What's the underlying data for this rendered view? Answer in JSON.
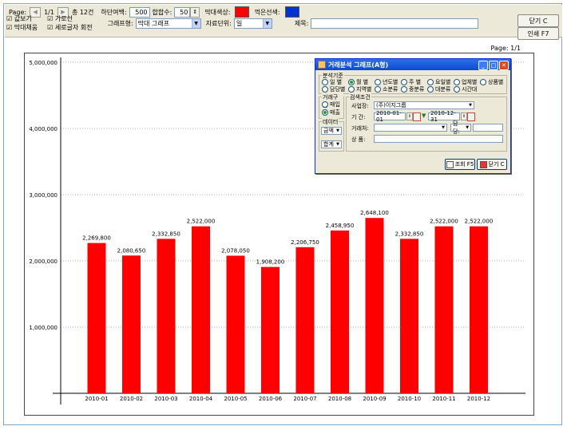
{
  "toolbar": {
    "page_label": "Page:",
    "page_value": "1/1",
    "total_label": "총 12건",
    "bottom_margin_label": "하단여백:",
    "bottom_margin_value": "500",
    "total_count_label": "합합수:",
    "total_count_value": "50",
    "bar_color_label": "막대색상:",
    "bar_color": "#ff0000",
    "line_color_label": "꺽은선색:",
    "line_color": "#0033cc",
    "checkbox_values": "☑ 값보기",
    "checkbox_bar_count": "☑ 막대채움",
    "checkbox_gridline": "☑ 가로선",
    "checkbox_rotate": "☑ 세로글자 회전",
    "graph_type_label": "그래프형:",
    "graph_type_value": "막대 그래프",
    "unit_label": "자료단위:",
    "unit_value": "일",
    "title_label": "제목:",
    "close_button": "닫기 C",
    "print_button": "인쇄 F7"
  },
  "page_indicator": "Page: 1/1",
  "dialog": {
    "title": "거래분석 그래프(A형)",
    "analysis_group_label": "분석기준",
    "analysis_options": [
      "일 별",
      "월 별",
      "년도별",
      "주 별",
      "요일별",
      "업체별",
      "상품별",
      "담당별",
      "지역별",
      "소분류",
      "중분류",
      "대분류",
      "시간대"
    ],
    "analysis_selected": "월 별",
    "trade_group_label": "거래구분",
    "trade_options": [
      "매입",
      "매출"
    ],
    "trade_selected": "매출",
    "search_group_label": "검색조건",
    "office_label": "사업장:",
    "office_value": "(주)이지그룹",
    "period_label": "기  간:",
    "period_from": "2010-01-01",
    "period_to": "2010-12-31",
    "partner_label": "거래처:",
    "staff_label": "담당:",
    "product_label": "상  품:",
    "data_group_label": "데이터",
    "data_value": "금액",
    "sum_value": "합계",
    "search_button": "조회 F5",
    "close_button": "닫기 C"
  },
  "chart_data": {
    "type": "bar",
    "categories": [
      "2010-01",
      "2010-02",
      "2010-03",
      "2010-04",
      "2010-05",
      "2010-06",
      "2010-07",
      "2010-08",
      "2010-09",
      "2010-10",
      "2010-11",
      "2010-12"
    ],
    "values": [
      2269800,
      2080650,
      2332850,
      2522000,
      2078050,
      1908200,
      2206750,
      2458950,
      2648100,
      2332850,
      2522000,
      2522000
    ],
    "value_labels": [
      "2,269,800",
      "2,080,650",
      "2,332,850",
      "2,522,000",
      "2,078,050",
      "1,908,200",
      "2,206,750",
      "2,458,950",
      "2,648,100",
      "2,332,850",
      "2,522,000",
      "2,522,000"
    ],
    "y_ticks": [
      1000000,
      2000000,
      3000000,
      4000000,
      5000000
    ],
    "y_tick_labels": [
      "1,000,000",
      "2,000,000",
      "3,000,000",
      "4,000,000",
      "5,000,000"
    ],
    "ylim": [
      0,
      5000000
    ],
    "bar_color": "#ff0000",
    "grid": true
  }
}
